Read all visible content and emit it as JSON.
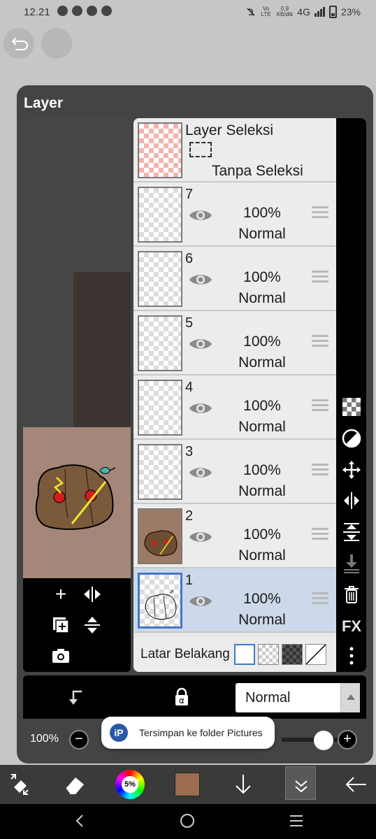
{
  "status_bar": {
    "time": "12.21",
    "net_speed": "0,9",
    "net_unit": "KB/dtk",
    "network": "4G",
    "volte": "Vo LTE",
    "battery": "23%"
  },
  "dialog": {
    "title": "Layer"
  },
  "selection_layer": {
    "title": "Layer Seleksi",
    "status": "Tanpa Seleksi"
  },
  "layers": [
    {
      "number": "7",
      "opacity": "100%",
      "mode": "Normal",
      "thumb": "empty",
      "selected": false
    },
    {
      "number": "6",
      "opacity": "100%",
      "mode": "Normal",
      "thumb": "empty",
      "selected": false
    },
    {
      "number": "5",
      "opacity": "100%",
      "mode": "Normal",
      "thumb": "empty",
      "selected": false
    },
    {
      "number": "4",
      "opacity": "100%",
      "mode": "Normal",
      "thumb": "empty",
      "selected": false
    },
    {
      "number": "3",
      "opacity": "100%",
      "mode": "Normal",
      "thumb": "empty",
      "selected": false
    },
    {
      "number": "2",
      "opacity": "100%",
      "mode": "Normal",
      "thumb": "colored",
      "selected": false
    },
    {
      "number": "1",
      "opacity": "100%",
      "mode": "Normal",
      "thumb": "lineart",
      "selected": true
    }
  ],
  "background": {
    "label": "Latar Belakang"
  },
  "sidebar": {
    "fx_label": "FX"
  },
  "blend": {
    "value": "Normal"
  },
  "opacity_control": {
    "value": "100%",
    "minus": "−",
    "plus": "+"
  },
  "toast": {
    "icon_text": "iP",
    "message": "Tersimpan ke folder Pictures"
  },
  "toolbar": {
    "brush_size": "5%",
    "color": "#9b6c4e"
  },
  "colors": {
    "accent": "#3f79c7",
    "selected_row": "#cdd9ea",
    "panel": "#444444"
  }
}
